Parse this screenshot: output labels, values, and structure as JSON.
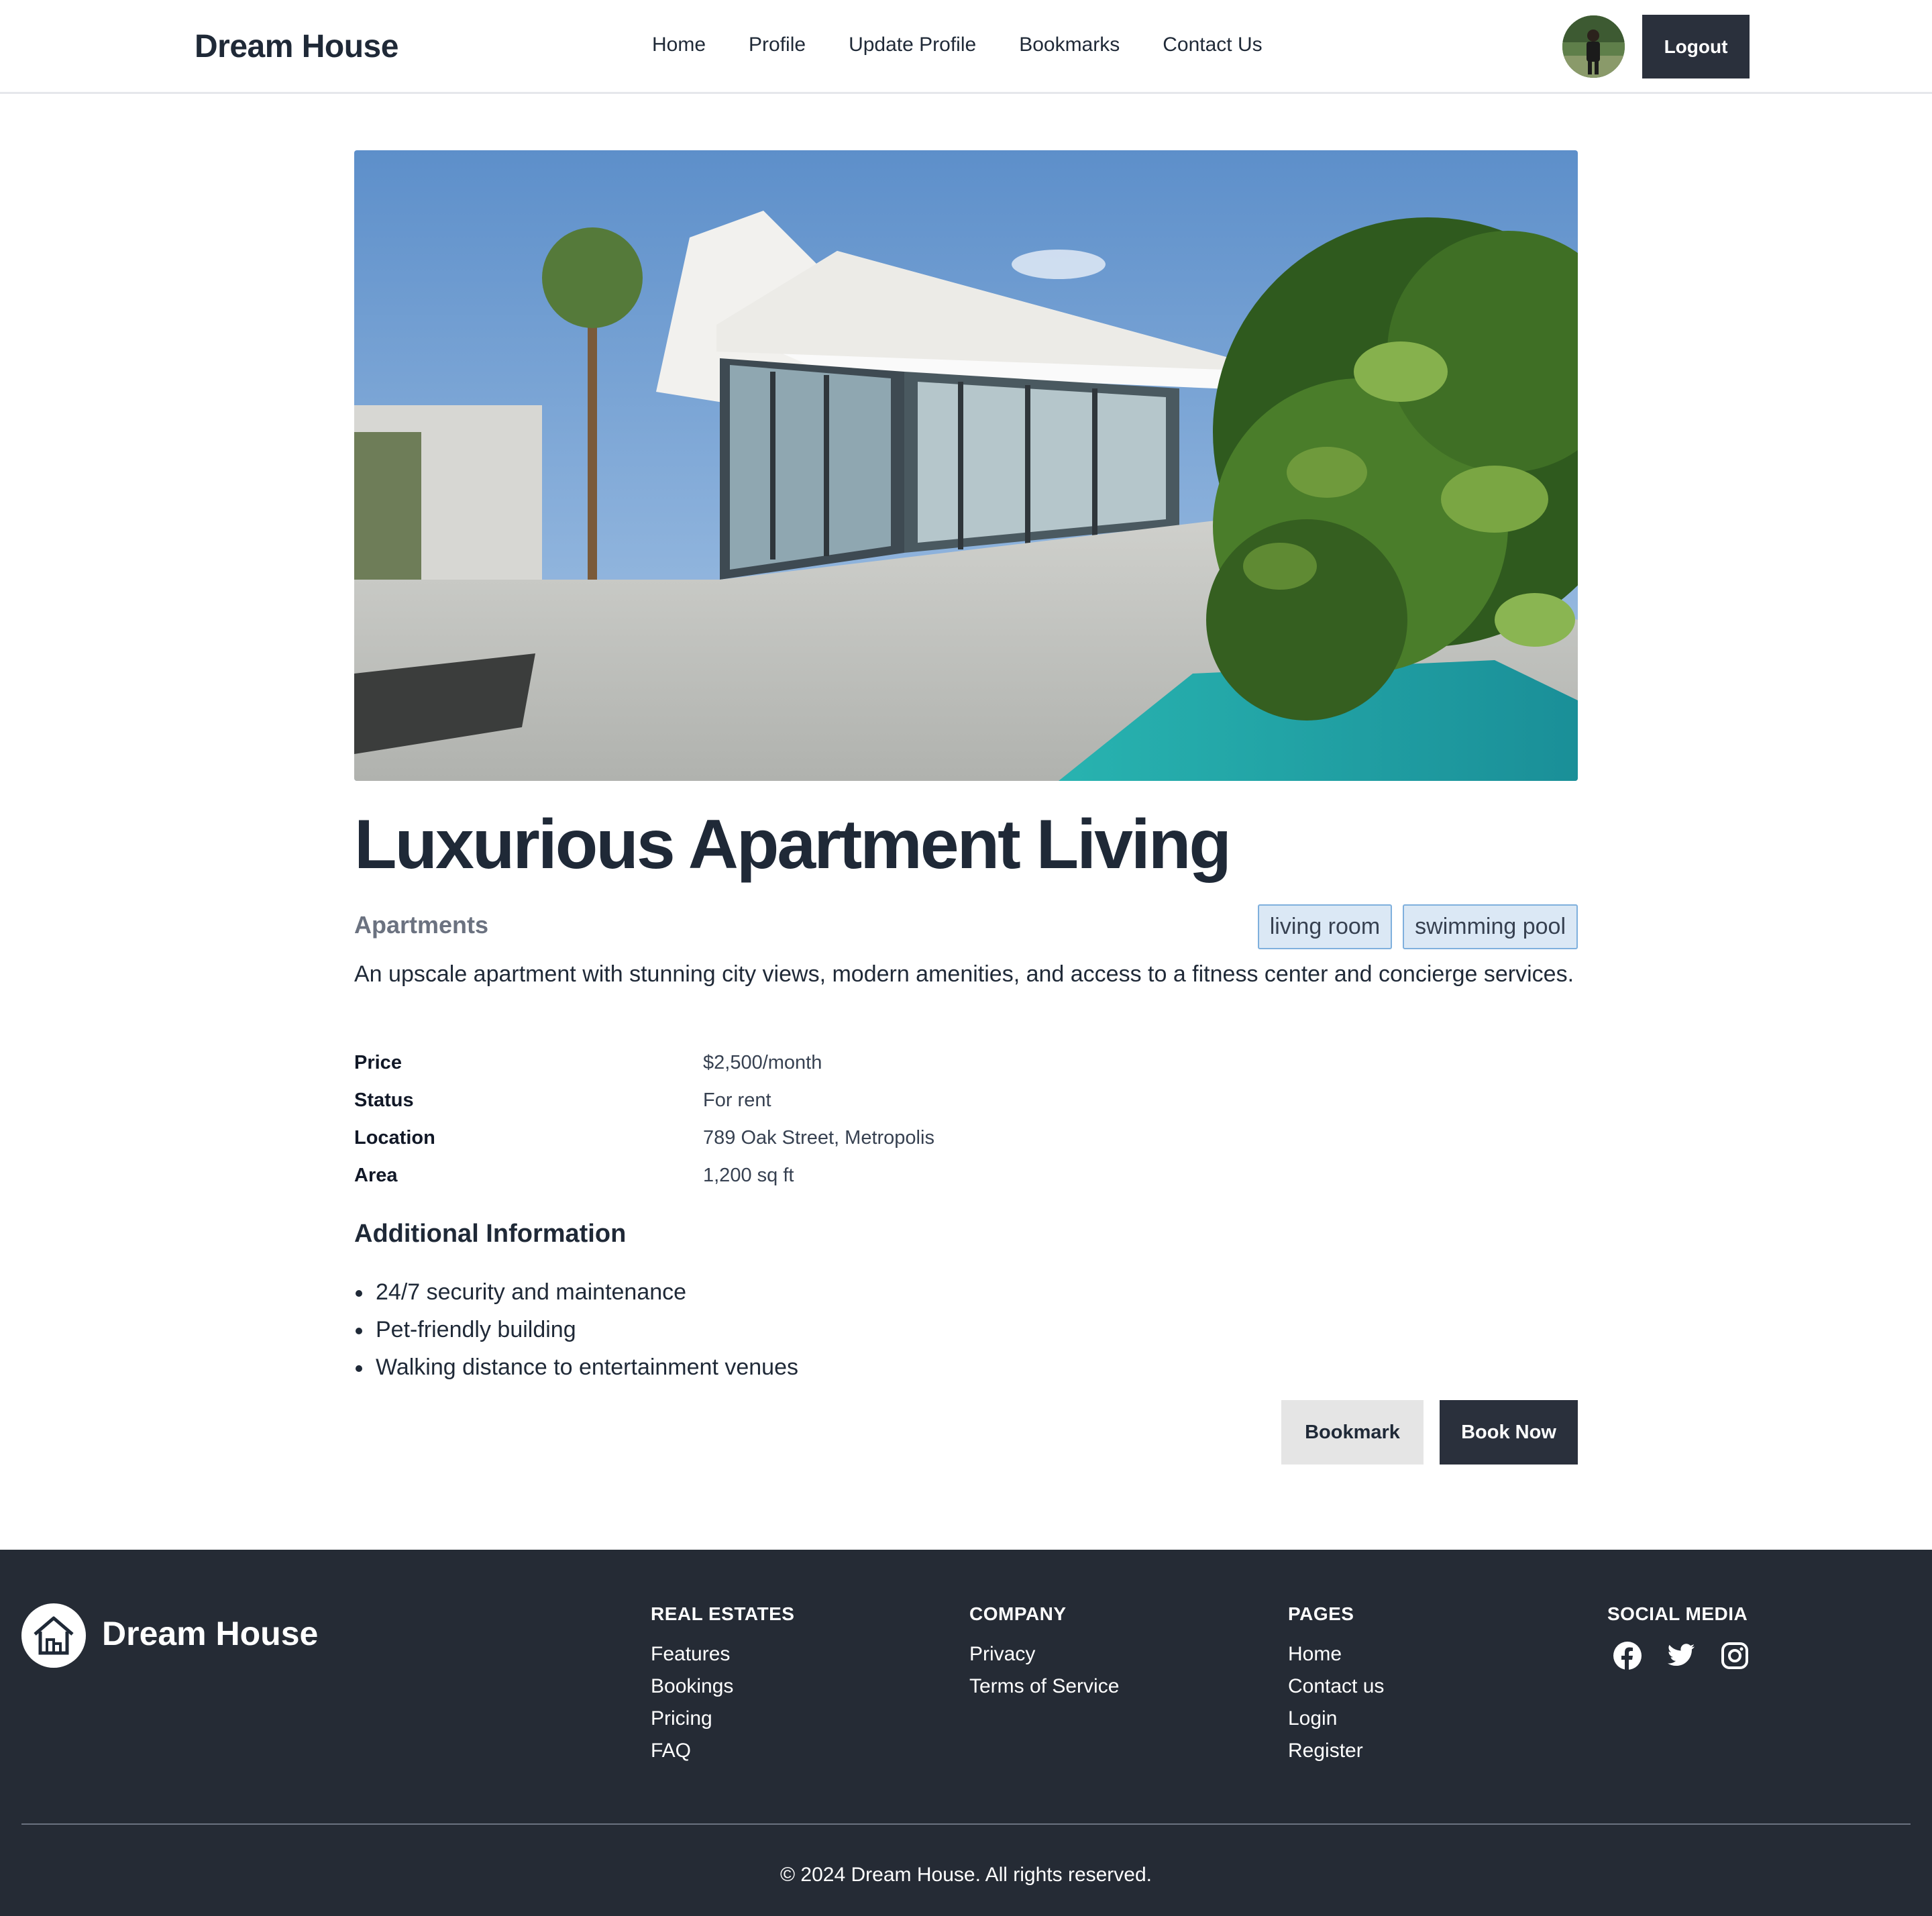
{
  "header": {
    "brand": "Dream House",
    "nav": [
      "Home",
      "Profile",
      "Update Profile",
      "Bookmarks",
      "Contact Us"
    ],
    "logout_label": "Logout"
  },
  "property": {
    "title": "Luxurious Apartment Living",
    "category": "Apartments",
    "tags": [
      "living room",
      "swimming pool"
    ],
    "description": "An upscale apartment with stunning city views, modern amenities, and access to a fitness center and concierge services.",
    "details": [
      {
        "label": "Price",
        "value": "$2,500/month"
      },
      {
        "label": "Status",
        "value": "For rent"
      },
      {
        "label": "Location",
        "value": "789 Oak Street, Metropolis"
      },
      {
        "label": "Area",
        "value": "1,200 sq ft"
      }
    ],
    "additional_title": "Additional Information",
    "additional": [
      "24/7 security and maintenance",
      "Pet-friendly building",
      "Walking distance to entertainment venues"
    ],
    "bookmark_label": "Bookmark",
    "book_label": "Book Now"
  },
  "footer": {
    "brand": "Dream House",
    "columns": [
      {
        "title": "REAL ESTATES",
        "links": [
          "Features",
          "Bookings",
          "Pricing",
          "FAQ"
        ]
      },
      {
        "title": "COMPANY",
        "links": [
          "Privacy",
          "Terms of Service"
        ]
      },
      {
        "title": "PAGES",
        "links": [
          "Home",
          "Contact us",
          "Login",
          "Register"
        ]
      }
    ],
    "social_title": "SOCIAL MEDIA",
    "social_icons": [
      "facebook-icon",
      "twitter-icon",
      "instagram-icon"
    ],
    "copyright": "© 2024 Dream House. All rights reserved."
  },
  "colors": {
    "dark": "#2a303c",
    "footer_bg": "#252b35",
    "tag_bg": "#dbe8f5",
    "tag_border": "#7fb0dd"
  }
}
